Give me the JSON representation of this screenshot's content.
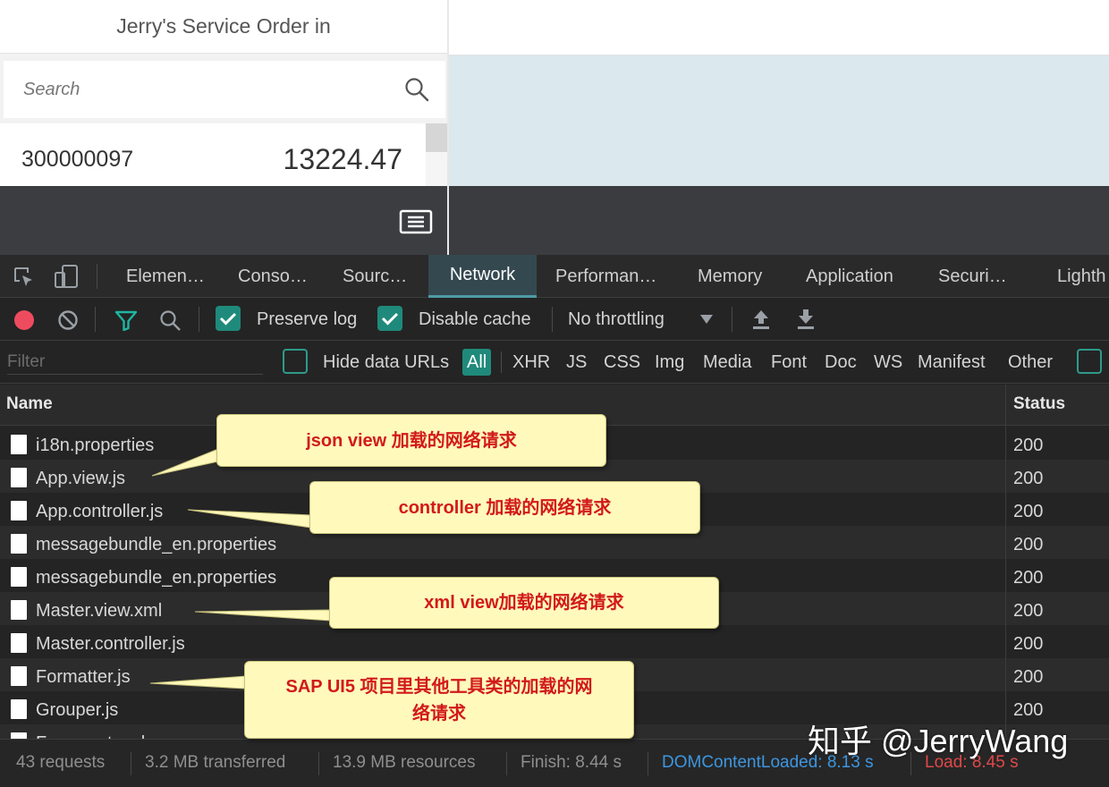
{
  "app": {
    "title": "Jerry's Service Order in",
    "search_placeholder": "Search",
    "list_item": {
      "id": "300000097",
      "amount": "13224.47"
    }
  },
  "devtools": {
    "tabs": [
      "Elemen…",
      "Conso…",
      "Sourc…",
      "Network",
      "Performan…",
      "Memory",
      "Application",
      "Securi…",
      "Lighth"
    ],
    "active_tab": "Network",
    "toolbar": {
      "preserve_log": "Preserve log",
      "disable_cache": "Disable cache",
      "throttling": "No throttling"
    },
    "filter": {
      "placeholder": "Filter",
      "hide_data_urls": "Hide data URLs",
      "types": [
        "All",
        "XHR",
        "JS",
        "CSS",
        "Img",
        "Media",
        "Font",
        "Doc",
        "WS",
        "Manifest",
        "Other"
      ]
    },
    "table": {
      "headers": {
        "name": "Name",
        "status": "Status"
      },
      "rows": [
        {
          "name": "i18n.properties",
          "status": "200"
        },
        {
          "name": "App.view.js",
          "status": "200"
        },
        {
          "name": "App.controller.js",
          "status": "200"
        },
        {
          "name": "messagebundle_en.properties",
          "status": "200"
        },
        {
          "name": "messagebundle_en.properties",
          "status": "200"
        },
        {
          "name": "Master.view.xml",
          "status": "200"
        },
        {
          "name": "Master.controller.js",
          "status": "200"
        },
        {
          "name": "Formatter.js",
          "status": "200"
        },
        {
          "name": "Grouper.js",
          "status": "200"
        },
        {
          "name": "Fragment.xml",
          "status": ""
        }
      ]
    },
    "status_bar": {
      "requests": "43 requests",
      "transferred": "3.2 MB transferred",
      "resources": "13.9 MB resources",
      "finish": "Finish: 8.44 s",
      "dom_loaded": "DOMContentLoaded: 8.13 s",
      "load": "Load: 8.45 s"
    }
  },
  "callouts": [
    "json view 加载的网络请求",
    "controller 加载的网络请求",
    "xml view加载的网络请求",
    "SAP UI5 项目里其他工具类的加载的网络请求"
  ],
  "watermark": "知乎 @JerryWang",
  "colors": {
    "accent": "#1f8a7b",
    "dom_loaded": "#3d96e0",
    "load": "#e04848",
    "callout_text": "#d21a1a",
    "callout_bg": "#fff9bc"
  }
}
